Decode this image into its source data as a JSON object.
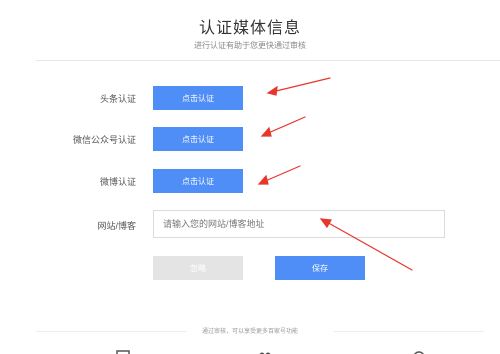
{
  "header": {
    "title": "认证媒体信息",
    "subtitle": "进行认证有助于您更快通过审核"
  },
  "form": {
    "toutiao": {
      "label": "头条认证",
      "button": "点击认证"
    },
    "wechat": {
      "label": "微信公众号认证",
      "button": "点击认证"
    },
    "weibo": {
      "label": "微博认证",
      "button": "点击认证"
    },
    "website": {
      "label": "网站/博客",
      "placeholder": "请输入您的网站/博客地址",
      "value": ""
    }
  },
  "actions": {
    "skip_label": "忽略",
    "save_label": "保存"
  },
  "footer": {
    "text": "通过审核，可以享受更多百家号功能"
  },
  "colors": {
    "primary": "#4f8ef7",
    "disabled": "#e4e4e4",
    "annotation": "#e8362a"
  },
  "icons": [
    "doc-icon",
    "people-icon",
    "circle-icon"
  ]
}
